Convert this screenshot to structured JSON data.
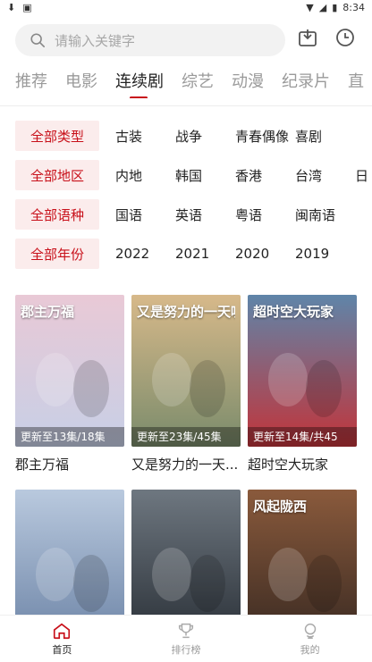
{
  "status": {
    "time": "8:34"
  },
  "search": {
    "placeholder": "请输入关键字"
  },
  "tabs": [
    "推荐",
    "电影",
    "连续剧",
    "综艺",
    "动漫",
    "纪录片",
    "直"
  ],
  "filters": [
    {
      "selected": "全部类型",
      "options": [
        "古装",
        "战争",
        "青春偶像",
        "喜剧"
      ]
    },
    {
      "selected": "全部地区",
      "options": [
        "内地",
        "韩国",
        "香港",
        "台湾",
        "日"
      ]
    },
    {
      "selected": "全部语种",
      "options": [
        "国语",
        "英语",
        "粤语",
        "闽南语"
      ]
    },
    {
      "selected": "全部年份",
      "options": [
        "2022",
        "2021",
        "2020",
        "2019"
      ]
    }
  ],
  "shows": [
    {
      "title": "郡主万福",
      "update": "更新至13集/18集",
      "art": "郡主万福",
      "colors": [
        "#e9c9d6",
        "#c7cfe6"
      ]
    },
    {
      "title": "又是努力的一天...",
      "update": "更新至23集/45集",
      "art": "又是努力的一天呢",
      "colors": [
        "#d7b98a",
        "#7a8b6b"
      ]
    },
    {
      "title": "超时空大玩家",
      "update": "更新至14集/共45",
      "art": "超时空大玩家",
      "colors": [
        "#5f85a9",
        "#c2343a"
      ]
    },
    {
      "title": "",
      "update": "",
      "art": "",
      "colors": [
        "#b9c9de",
        "#6f86a8"
      ]
    },
    {
      "title": "",
      "update": "",
      "art": "",
      "colors": [
        "#6e7780",
        "#2b3138"
      ]
    },
    {
      "title": "",
      "update": "",
      "art": "风起陇西",
      "colors": [
        "#8a5a3c",
        "#3a2a22"
      ]
    }
  ],
  "nav": [
    {
      "label": "首页",
      "icon": "home-icon"
    },
    {
      "label": "排行榜",
      "icon": "trophy-icon"
    },
    {
      "label": "我的",
      "icon": "profile-icon"
    }
  ]
}
